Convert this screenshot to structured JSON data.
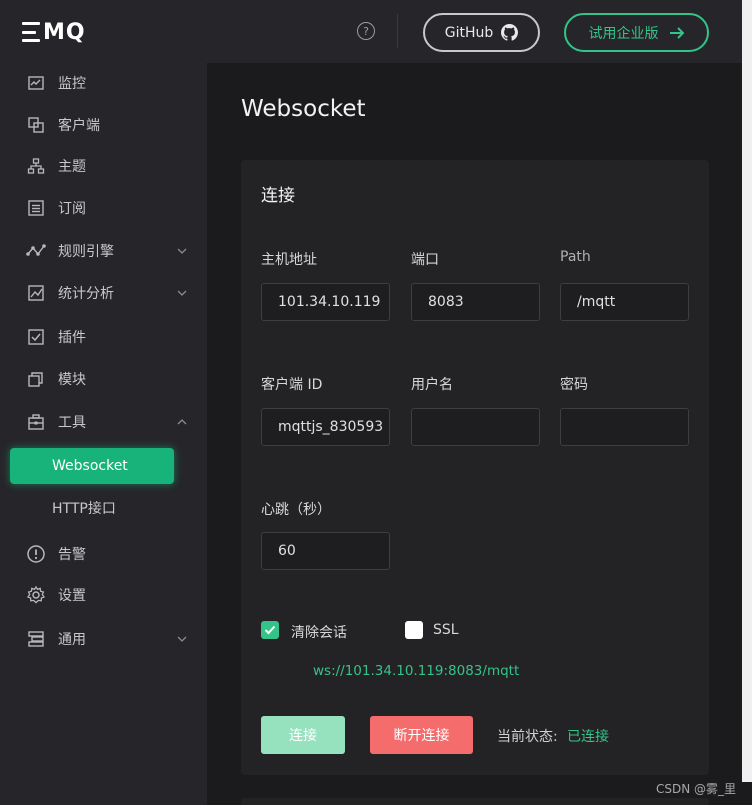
{
  "brand": {
    "logo_text": "MQ"
  },
  "sidebar": {
    "items": [
      {
        "label": "监控",
        "icon": "monitor-icon"
      },
      {
        "label": "客户端",
        "icon": "clients-icon"
      },
      {
        "label": "主题",
        "icon": "topics-icon"
      },
      {
        "label": "订阅",
        "icon": "subscriptions-icon"
      },
      {
        "label": "规则引擎",
        "icon": "rule-engine-icon"
      },
      {
        "label": "统计分析",
        "icon": "analytics-icon"
      },
      {
        "label": "插件",
        "icon": "plugins-icon"
      },
      {
        "label": "模块",
        "icon": "modules-icon"
      },
      {
        "label": "工具",
        "icon": "tools-icon"
      },
      {
        "label": "告警",
        "icon": "alarm-icon"
      },
      {
        "label": "设置",
        "icon": "settings-icon"
      },
      {
        "label": "通用",
        "icon": "general-icon"
      }
    ],
    "tools_sub": [
      {
        "label": "Websocket",
        "active": true
      },
      {
        "label": "HTTP接口",
        "active": false
      }
    ]
  },
  "header": {
    "github_label": "GitHub",
    "enterprise_label": "试用企业版"
  },
  "page": {
    "title": "Websocket",
    "card_title": "连接",
    "host_label": "主机地址",
    "host_value": "101.34.10.119",
    "port_label": "端口",
    "port_value": "8083",
    "path_label": "Path",
    "path_value": "/mqtt",
    "client_id_label": "客户端 ID",
    "client_id_value": "mqttjs_830593",
    "username_label": "用户名",
    "username_value": "",
    "password_label": "密码",
    "password_value": "",
    "keepalive_label": "心跳（秒）",
    "keepalive_value": "60",
    "clean_session_label": "清除会话",
    "clean_session_checked": true,
    "ssl_label": "SSL",
    "ssl_checked": false,
    "ws_url": "ws://101.34.10.119:8083/mqtt",
    "connect_label": "连接",
    "disconnect_label": "断开连接",
    "status_label": "当前状态:",
    "status_value": "已连接"
  },
  "colors": {
    "accent": "#34c388",
    "danger": "#f56c6c",
    "sidebar_bg": "#26262a",
    "page_bg": "#1b1b1d"
  },
  "watermark": "CSDN @雾_里"
}
